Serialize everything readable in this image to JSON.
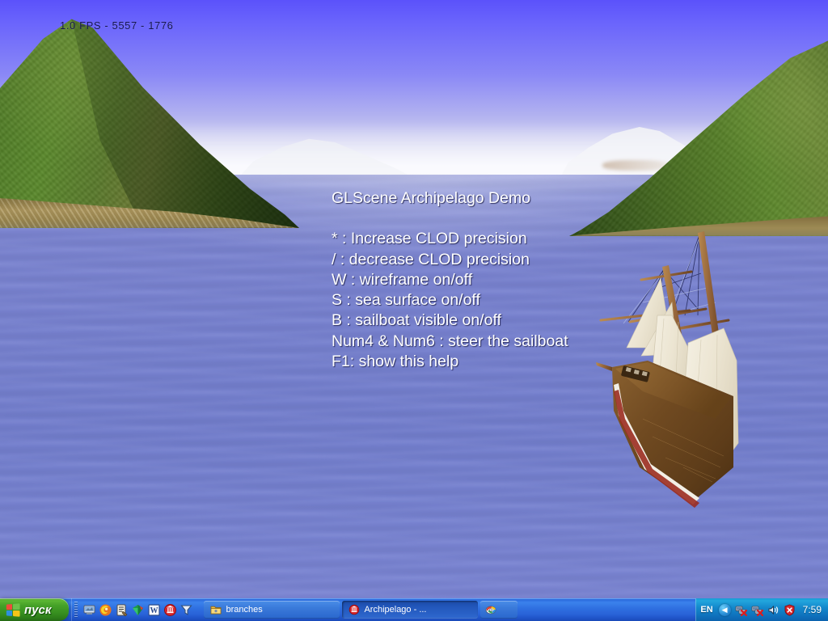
{
  "app": {
    "window_title": "Archipelago - ...",
    "hud": {
      "fps_line": "1.0 FPS - 5557 - 1776"
    },
    "help": {
      "title": "GLScene Archipelago Demo",
      "lines": [
        "* : Increase CLOD precision",
        "/ : decrease CLOD precision",
        "W : wireframe on/off",
        "S : sea surface on/off",
        "B : sailboat visible on/off",
        "Num4 & Num6 : steer the sailboat",
        "F1: show this help"
      ]
    },
    "scene": {
      "sky_top_color": "#5b52fb",
      "sky_horizon_color": "#f7f7fa",
      "sea_color": "#7781cf",
      "island_green": "#5b8a2c",
      "island_beach": "#b09a60",
      "sail_color": "#efe9d8",
      "hull_color": "#6f4b22",
      "hull_stripe_color": "#9b2c20"
    }
  },
  "taskbar": {
    "start": {
      "label": "пуск",
      "icon": "windows-flag-icon"
    },
    "quick_launch": [
      {
        "name": "show-desktop",
        "icon": "show-desktop-icon"
      },
      {
        "name": "firefox",
        "icon": "firefox-icon"
      },
      {
        "name": "notes",
        "icon": "notes-icon"
      },
      {
        "name": "gem",
        "icon": "gem-icon"
      },
      {
        "name": "word",
        "icon": "word-icon",
        "glyph": "W"
      },
      {
        "name": "delphi",
        "icon": "delphi-icon"
      },
      {
        "name": "filter",
        "icon": "funnel-icon"
      }
    ],
    "windows": [
      {
        "label": "branches",
        "icon": "folder-icon",
        "active": false
      },
      {
        "label": "Archipelago - ...",
        "icon": "delphi-icon",
        "active": true
      },
      {
        "label": "",
        "icon": "paint-icon",
        "active": false
      }
    ],
    "tray": {
      "language": "EN",
      "expand_glyph": "◀",
      "icons": [
        {
          "name": "network-disconnected-1",
          "icon": "network-error-icon"
        },
        {
          "name": "network-disconnected-2",
          "icon": "network-error-icon"
        },
        {
          "name": "volume",
          "icon": "speaker-icon"
        },
        {
          "name": "security-alert",
          "icon": "shield-alert-icon"
        }
      ],
      "clock": "7:59"
    }
  }
}
